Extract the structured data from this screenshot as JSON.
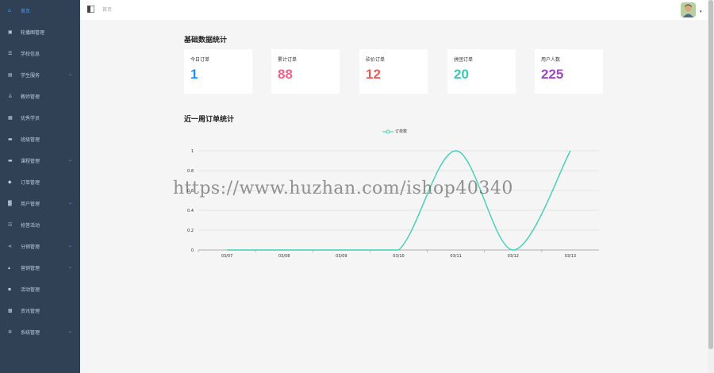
{
  "sidebar": {
    "items": [
      {
        "label": "首页",
        "icon": "home-icon",
        "glyph": "⌂",
        "has_children": false,
        "active": true
      },
      {
        "label": "轮播图管理",
        "icon": "image-icon",
        "glyph": "▣",
        "has_children": false
      },
      {
        "label": "学校信息",
        "icon": "info-icon",
        "glyph": "☰",
        "has_children": false
      },
      {
        "label": "学生服务",
        "icon": "service-icon",
        "glyph": "▤",
        "has_children": true
      },
      {
        "label": "教师管理",
        "icon": "user-icon",
        "glyph": "♙",
        "has_children": false
      },
      {
        "label": "优秀学员",
        "icon": "star-icon",
        "glyph": "▦",
        "has_children": false
      },
      {
        "label": "班级管理",
        "icon": "class-icon",
        "glyph": "▬",
        "has_children": false
      },
      {
        "label": "课程管理",
        "icon": "course-icon",
        "glyph": "▬",
        "has_children": true
      },
      {
        "label": "订单管理",
        "icon": "order-icon",
        "glyph": "◆",
        "has_children": false
      },
      {
        "label": "用户管理",
        "icon": "users-icon",
        "glyph": "▓",
        "has_children": true
      },
      {
        "label": "抢答活动",
        "icon": "activity-icon",
        "glyph": "☷",
        "has_children": false
      },
      {
        "label": "分销管理",
        "icon": "share-icon",
        "glyph": "⋖",
        "has_children": true
      },
      {
        "label": "营销管理",
        "icon": "chart-icon",
        "glyph": "▴",
        "has_children": true
      },
      {
        "label": "活动管理",
        "icon": "event-icon",
        "glyph": "▪",
        "has_children": false
      },
      {
        "label": "资讯管理",
        "icon": "news-icon",
        "glyph": "▩",
        "has_children": false
      },
      {
        "label": "系统管理",
        "icon": "gear-icon",
        "glyph": "✲",
        "has_children": true
      }
    ]
  },
  "header": {
    "breadcrumb": "首页",
    "hamburger_icon": "hamburger-icon",
    "avatar_icon": "avatar-icon"
  },
  "stats": {
    "title": "基础数据统计",
    "cards": [
      {
        "label": "今日订单",
        "value": "1",
        "color": "#1e90ff"
      },
      {
        "label": "累计订单",
        "value": "88",
        "color": "#f0648c"
      },
      {
        "label": "砍价订单",
        "value": "12",
        "color": "#ee5a5a"
      },
      {
        "label": "拼团订单",
        "value": "20",
        "color": "#3cc8b4"
      },
      {
        "label": "用户人数",
        "value": "225",
        "color": "#a046c8"
      }
    ]
  },
  "chart_section": {
    "title": "近一周订单统计"
  },
  "chart_data": {
    "type": "line",
    "title": "",
    "xlabel": "",
    "ylabel": "",
    "categories": [
      "03/07",
      "03/08",
      "03/09",
      "03/10",
      "03/11",
      "03/12",
      "03/13"
    ],
    "series": [
      {
        "name": "订单数",
        "values": [
          0,
          0,
          0,
          0,
          1,
          0,
          1
        ],
        "color": "#3fd1b5"
      }
    ],
    "ylim": [
      0,
      1
    ],
    "yticks": [
      "0",
      "0.2",
      "0.4",
      "0.6",
      "0.8",
      "1"
    ],
    "grid": true,
    "smooth": true,
    "legend_position": "top-center"
  },
  "watermark": "https://www.huzhan.com/ishop40340"
}
